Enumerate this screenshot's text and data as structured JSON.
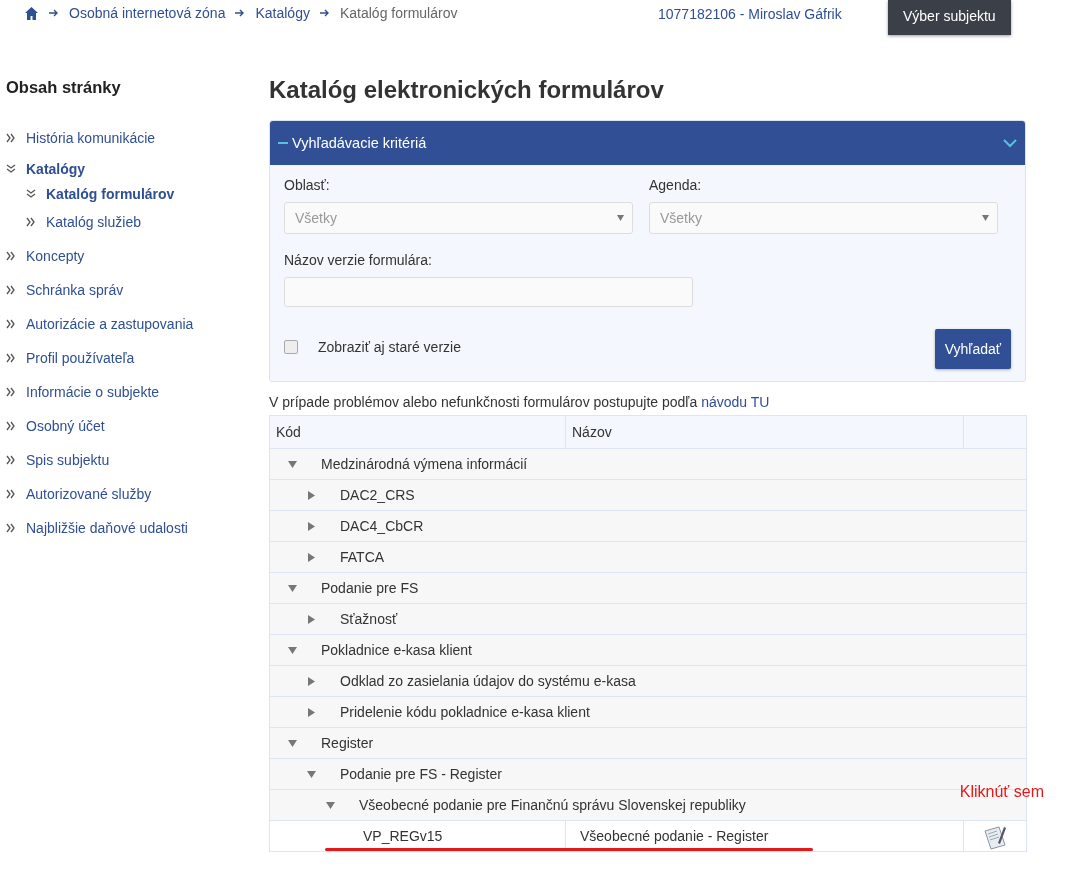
{
  "breadcrumb": [
    {
      "label": "Osobná internetová zóna",
      "current": false
    },
    {
      "label": "Katalógy",
      "current": false
    },
    {
      "label": "Katalóg formulárov",
      "current": true
    }
  ],
  "user": "1077182106 - Miroslav Gáfrik",
  "subject_button": "Výber subjektu",
  "sidebar": {
    "title": "Obsah stránky",
    "items": [
      {
        "label": "História komunikácie",
        "selected": false,
        "expanded": false
      },
      {
        "label": "Katalógy",
        "selected": true,
        "expanded": true,
        "children": [
          {
            "label": "Katalóg formulárov",
            "selected": true,
            "expanded": true
          },
          {
            "label": "Katalóg služieb",
            "selected": false,
            "expanded": false
          }
        ]
      },
      {
        "label": "Koncepty",
        "selected": false,
        "expanded": false
      },
      {
        "label": "Schránka správ",
        "selected": false,
        "expanded": false
      },
      {
        "label": "Autorizácie a zastupovania",
        "selected": false,
        "expanded": false
      },
      {
        "label": "Profil používateľa",
        "selected": false,
        "expanded": false
      },
      {
        "label": "Informácie o subjekte",
        "selected": false,
        "expanded": false
      },
      {
        "label": "Osobný účet",
        "selected": false,
        "expanded": false
      },
      {
        "label": "Spis subjektu",
        "selected": false,
        "expanded": false
      },
      {
        "label": "Autorizované služby",
        "selected": false,
        "expanded": false
      },
      {
        "label": "Najbližšie daňové udalosti",
        "selected": false,
        "expanded": false
      }
    ]
  },
  "page_title": "Katalóg elektronických formulárov",
  "search_panel": {
    "title": "Vyhľadávacie kritériá",
    "expanded": true,
    "area": {
      "label": "Oblasť:",
      "value": "Všetky"
    },
    "agenda": {
      "label": "Agenda:",
      "value": "Všetky"
    },
    "form_name": {
      "label": "Názov verzie formulára:"
    },
    "old_versions": {
      "label": "Zobraziť aj staré verzie",
      "checked": false
    },
    "search_button": "Vyhľadať"
  },
  "notice": {
    "text": "V prípade problémov alebo nefunkčnosti formulárov postupujte podľa",
    "link": "návodu TU"
  },
  "table": {
    "columns": [
      "Kód",
      "Názov"
    ],
    "rows": [
      {
        "label": "Medzinárodná výmena informácií",
        "expanded": true,
        "children": [
          {
            "label": "DAC2_CRS",
            "expanded": false
          },
          {
            "label": "DAC4_CbCR",
            "expanded": false
          },
          {
            "label": "FATCA",
            "expanded": false
          }
        ]
      },
      {
        "label": "Podanie pre FS",
        "expanded": true,
        "children": [
          {
            "label": "Sťažnosť",
            "expanded": false
          }
        ]
      },
      {
        "label": "Pokladnice e-kasa klient",
        "expanded": true,
        "children": [
          {
            "label": "Odklad zo zasielania údajov do systému e-kasa",
            "expanded": false
          },
          {
            "label": "Pridelenie kódu pokladnice e-kasa klient",
            "expanded": false
          }
        ]
      },
      {
        "label": "Register",
        "expanded": true,
        "children": [
          {
            "label": "Podanie pre FS - Register",
            "expanded": true,
            "children": [
              {
                "label": "Všeobecné podanie pre Finančnú správu Slovenskej republiky",
                "expanded": true,
                "children": [
                  {
                    "code": "VP_REGv15",
                    "name": "Všeobecné podanie - Register"
                  }
                ]
              }
            ]
          }
        ]
      }
    ]
  },
  "annotation": {
    "text": "Kliknúť sem"
  }
}
